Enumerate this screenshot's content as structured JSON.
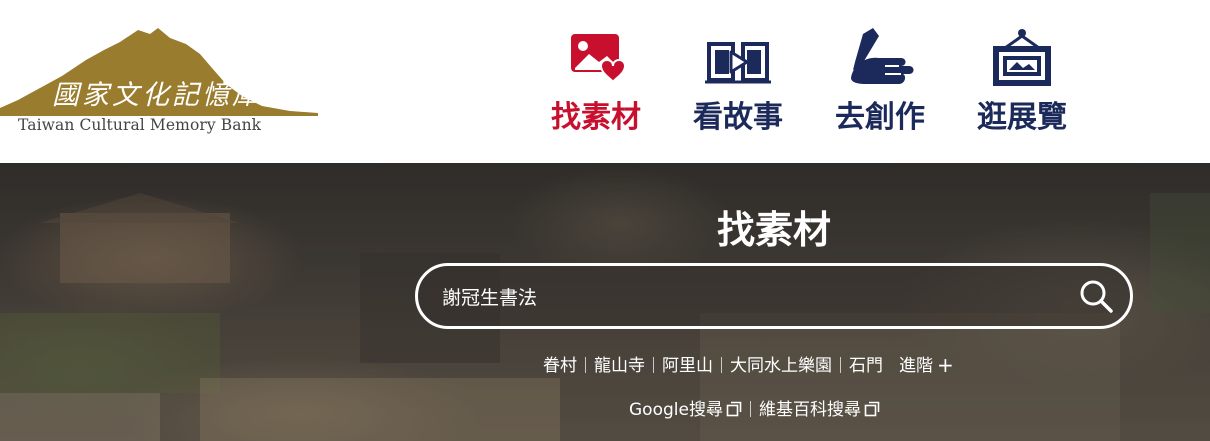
{
  "logo": {
    "name": "國家文化記憶庫",
    "subtitle": "Taiwan Cultural Memory Bank"
  },
  "nav": [
    {
      "label": "找素材",
      "icon": "image-heart-icon",
      "active": true
    },
    {
      "label": "看故事",
      "icon": "book-play-icon",
      "active": false
    },
    {
      "label": "去創作",
      "icon": "hand-writing-icon",
      "active": false
    },
    {
      "label": "逛展覽",
      "icon": "framed-picture-icon",
      "active": false
    }
  ],
  "hero": {
    "title": "找素材",
    "search": {
      "value": "謝冠生書法",
      "button_icon": "search-icon"
    },
    "tags": [
      "眷村",
      "龍山寺",
      "阿里山",
      "大同水上樂園",
      "石門"
    ],
    "advanced_label": "進階",
    "external_links": [
      {
        "label": "Google搜尋",
        "icon": "external-link-icon"
      },
      {
        "label": "維基百科搜尋",
        "icon": "external-link-icon"
      }
    ]
  },
  "colors": {
    "accent_red": "#c8102e",
    "nav_navy": "#1b2a5a",
    "logo_gold": "#9a7c2e"
  }
}
